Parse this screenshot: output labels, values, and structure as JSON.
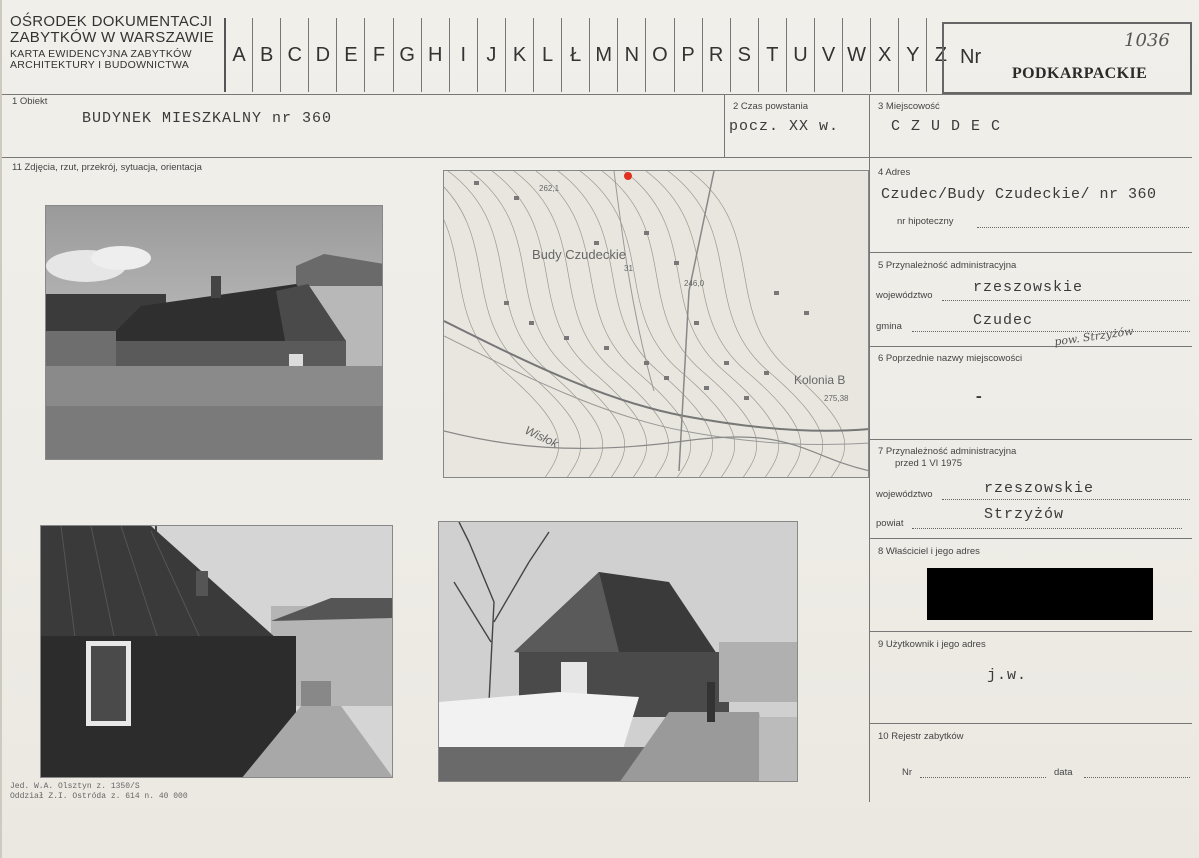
{
  "header": {
    "institution_line1": "OŚRODEK DOKUMENTACJI",
    "institution_line2": "ZABYTKÓW W WARSZAWIE",
    "institution_line3": "KARTA EWIDENCYJNA ZABYTKÓW",
    "institution_line4": "ARCHITEKTURY I BUDOWNICTWA",
    "alphabet": [
      "A",
      "B",
      "C",
      "D",
      "E",
      "F",
      "G",
      "H",
      "I",
      "J",
      "K",
      "L",
      "Ł",
      "M",
      "N",
      "O",
      "P",
      "R",
      "S",
      "T",
      "U",
      "V",
      "W",
      "X",
      "Y",
      "Z"
    ],
    "nr_label": "Nr",
    "nr_value": "1036",
    "region": "PODKARPACKIE"
  },
  "fields": {
    "obiekt_label": "1  Obiekt",
    "obiekt_value": "BUDYNEK  MIESZKALNY  nr 360",
    "czas_label": "2  Czas powstania",
    "czas_value": "pocz. XX w.",
    "miejscowosc_label": "3  Miejscowość",
    "miejscowosc_value": "C Z U D E C",
    "zdjecia_label": "11  Zdjęcia, rzut, przekrój, sytuacja, orientacja",
    "adres_label": "4  Adres",
    "adres_value": "Czudec/Budy Czudeckie/ nr 360",
    "hipoteczny_label": "nr hipoteczny",
    "przyn_label": "5  Przynależność administracyjna",
    "woj_label": "województwo",
    "woj_value": "rzeszowskie",
    "gmina_label": "gmina",
    "gmina_value": "Czudec",
    "pow_note": "pow. Strzyżów",
    "poprz_label": "6  Poprzednie nazwy miejscowości",
    "poprz_value": "-",
    "przyn2_label_1": "7  Przynależność administracyjna",
    "przyn2_label_2": "przed 1 VI 1975",
    "woj2_label": "województwo",
    "woj2_value": "rzeszowskie",
    "powiat_label": "powiat",
    "powiat_value": "Strzyżów",
    "wlasciciel_label": "8  Właściciel i jego adres",
    "uzytkownik_label": "9  Użytkownik i jego adres",
    "uzytkownik_value": "j.w.",
    "rejestr_label": "10  Rejestr zabytków",
    "rejestr_nr_label": "Nr",
    "rejestr_data_label": "data"
  },
  "map": {
    "place_label": "Budy Czudeckie",
    "village_label": "Kolonia B",
    "river_label": "Wisłok",
    "spot_height_1": "262,1",
    "spot_height_2": "246,0",
    "spot_height_3": "275,38",
    "spot_height_4": "31",
    "dot_color": "#e0301e"
  },
  "footer": {
    "line1": "Jed. W.A. Olsztyn z. 1350/S",
    "line2": "Oddział Z.I. Ostróda z. 614 n. 40 000"
  }
}
